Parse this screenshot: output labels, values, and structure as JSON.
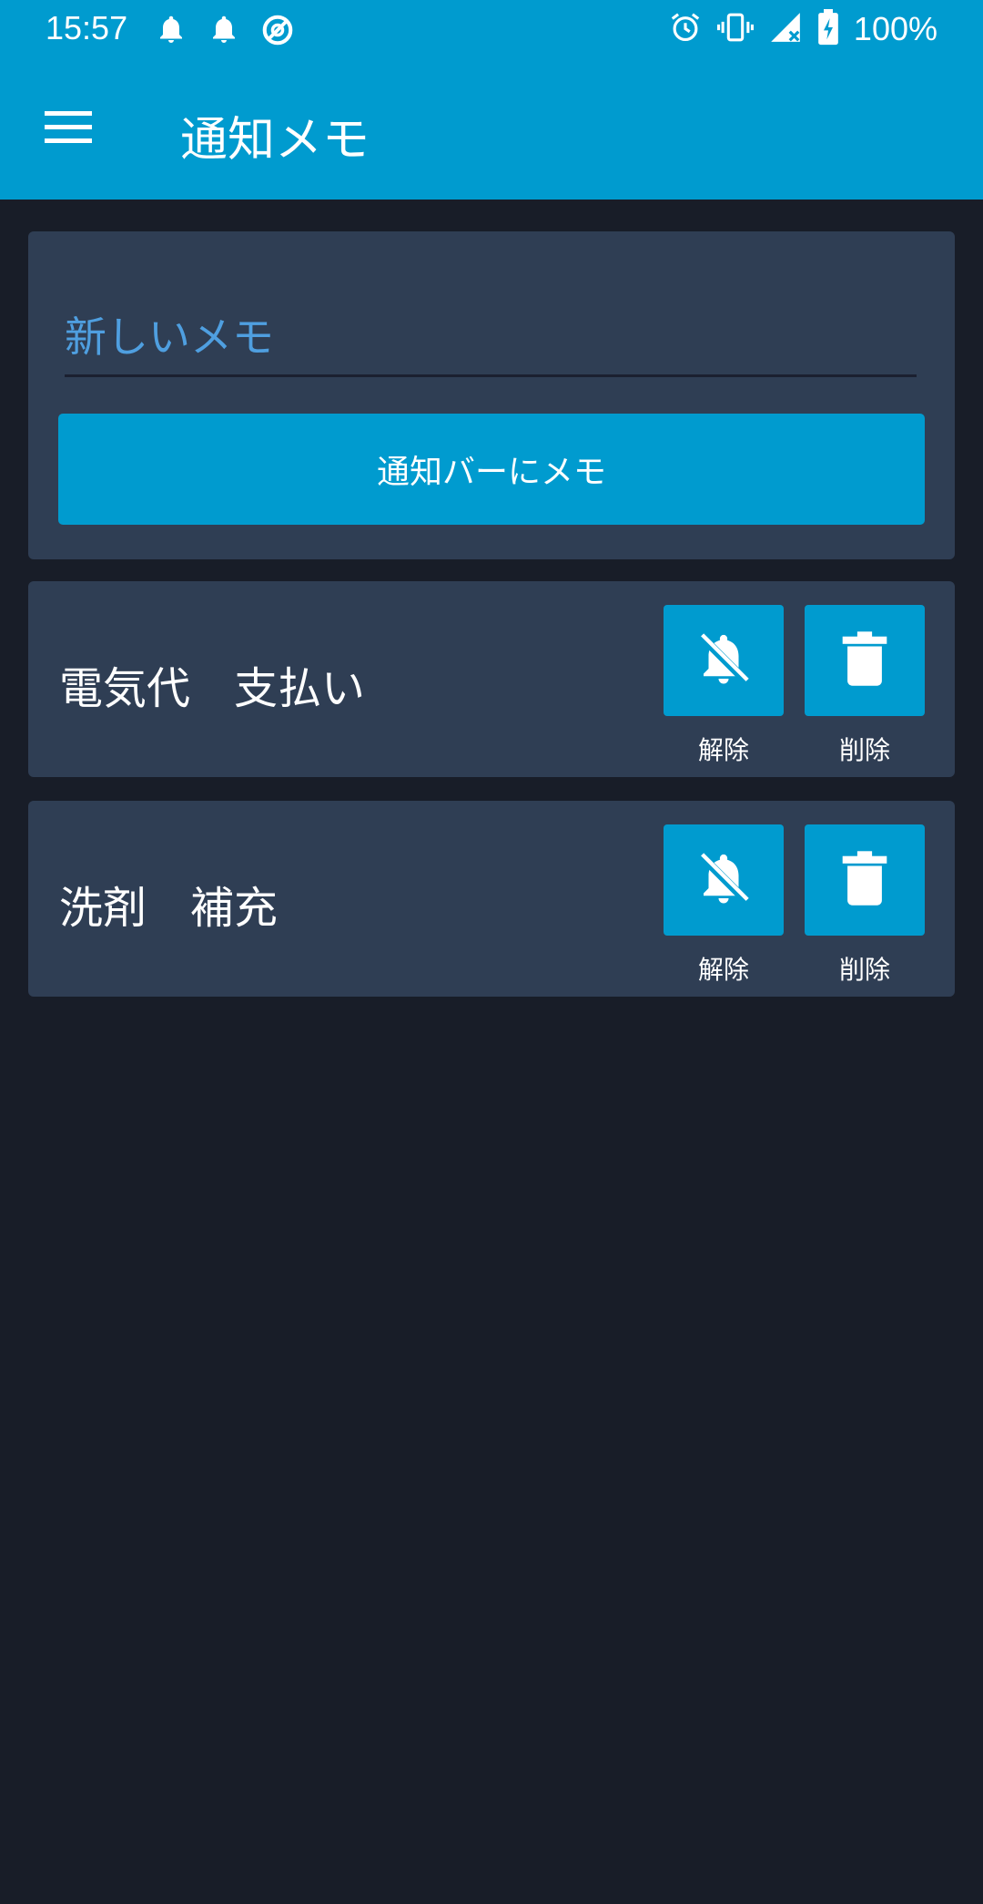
{
  "status_bar": {
    "time": "15:57",
    "left_icons": [
      "bell-icon",
      "bell-icon",
      "data-saver-icon"
    ],
    "right_icons": [
      "alarm-icon",
      "vibrate-icon",
      "signal-icon",
      "battery-charging-icon"
    ],
    "battery": "100%"
  },
  "app_bar": {
    "menu_icon": "hamburger-menu-icon",
    "title": "通知メモ"
  },
  "compose": {
    "placeholder": "新しいメモ",
    "value": "",
    "button_label": "通知バーにメモ"
  },
  "memos": [
    {
      "text": "電気代　支払い",
      "dismiss_label": "解除",
      "delete_label": "削除"
    },
    {
      "text": "洗剤　補充",
      "dismiss_label": "解除",
      "delete_label": "削除"
    }
  ],
  "colors": {
    "accent": "#009bcf",
    "background": "#181d28",
    "card": "#2f3e54",
    "placeholder": "#4f9fe0"
  }
}
